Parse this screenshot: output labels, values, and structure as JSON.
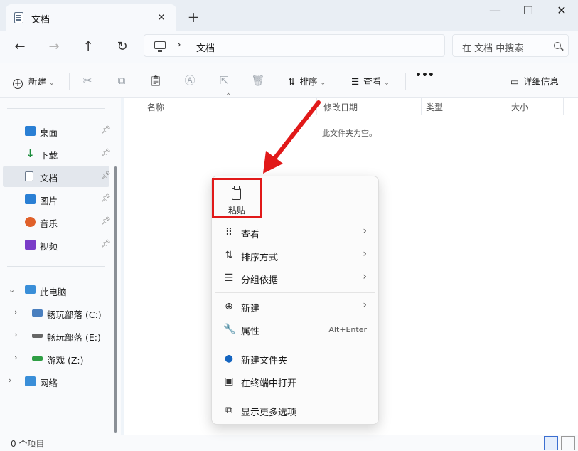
{
  "tab": {
    "title": "文档",
    "close": "✕",
    "new_tab": "+"
  },
  "window": {
    "minimize": "—",
    "maximize": "☐",
    "close": "✕"
  },
  "nav": {
    "back": "←",
    "forward": "→",
    "up": "↑",
    "refresh": "↻"
  },
  "address": {
    "separator": "›",
    "path": "文档"
  },
  "search": {
    "placeholder": "在 文档 中搜索"
  },
  "toolbar": {
    "new_label": "新建",
    "sort_label": "排序",
    "view_label": "查看",
    "more": "•••",
    "details_label": "详细信息",
    "icons": [
      "cut-icon",
      "copy-icon",
      "paste-icon",
      "rename-icon",
      "share-icon",
      "delete-icon"
    ]
  },
  "sidebar": {
    "quick_access": [
      {
        "label": "桌面",
        "color": "#2a7fd4"
      },
      {
        "label": "下载",
        "color": "#1c8c3c"
      },
      {
        "label": "文档",
        "color": "#6c7a8c",
        "selected": true
      },
      {
        "label": "图片",
        "color": "#2a7fd4"
      },
      {
        "label": "音乐",
        "color": "#e0602a"
      },
      {
        "label": "视频",
        "color": "#7a3cc8"
      }
    ],
    "this_pc": "此电脑",
    "drives": [
      "畅玩部落 (C:)",
      "畅玩部落 (E:)",
      "游戏 (Z:)"
    ],
    "network": "网络"
  },
  "columns": [
    "名称",
    "修改日期",
    "类型",
    "大小"
  ],
  "empty_message": "此文件夹为空。",
  "status": {
    "item_count": "0 个项目"
  },
  "context_menu": {
    "paste_label": "粘贴",
    "items": [
      {
        "label": "查看",
        "icon": "⠿",
        "submenu": "›"
      },
      {
        "label": "排序方式",
        "icon": "⇅",
        "submenu": "›"
      },
      {
        "label": "分组依据",
        "icon": "☰",
        "submenu": "›"
      },
      {
        "label": "新建",
        "icon": "⊕",
        "submenu": "›"
      },
      {
        "label": "属性",
        "icon": "🔧",
        "shortcut": "Alt+Enter"
      },
      {
        "label": "新建文件夹",
        "icon": "●"
      },
      {
        "label": "在终端中打开",
        "icon": "▣"
      },
      {
        "label": "显示更多选项",
        "icon": "⧉"
      }
    ]
  },
  "colors": {
    "highlight": "#e11919",
    "accent": "#3b6fd1"
  }
}
